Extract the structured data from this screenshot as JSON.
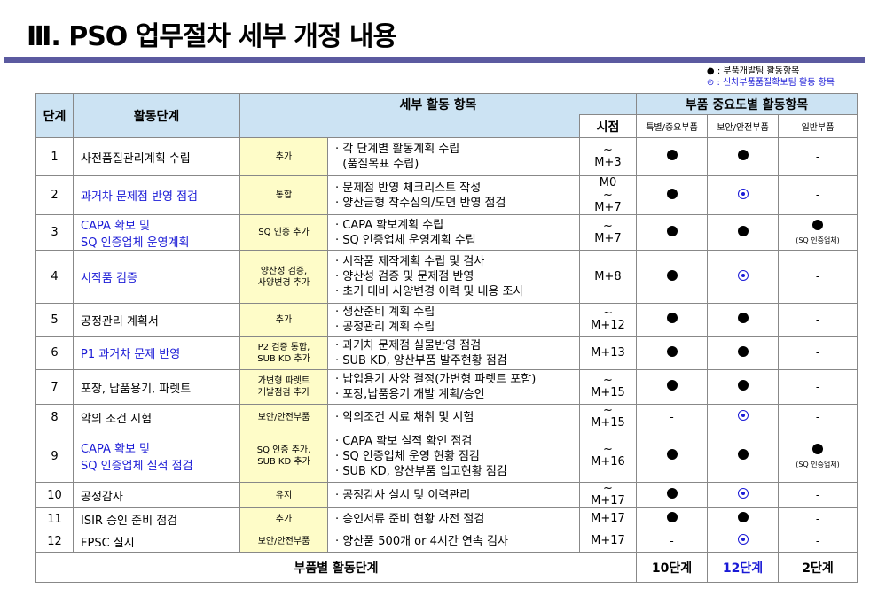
{
  "title": "Ⅲ. PSO 업무절차 세부 개정 내용",
  "legend": {
    "filled": "● : 부품개발팀 활동항목",
    "circled": "⊙ : 신차부품품질확보팀 활동 항목"
  },
  "header": {
    "stage": "단계",
    "activity": "활동단계",
    "detail": "세부 활동 항목",
    "timing": "시점",
    "importance": "부품 중요도별 활동항목",
    "cat1": "특별/중요부품",
    "cat2": "보안/안전부품",
    "cat3": "일반부품"
  },
  "rows": [
    {
      "no": "1",
      "activity": "사전품질관리계획 수립",
      "tag": "추가",
      "details": [
        "· 각 단계별 활동계획 수립",
        "  (품질목표 수립)"
      ],
      "time": "~\nM+3",
      "c1": "dot",
      "c2": "dot",
      "c3": "-"
    },
    {
      "no": "2",
      "activity": "과거차 문제점 반영 점검",
      "tag": "통합",
      "details": [
        "· 문제점 반영 체크리스트 작성",
        "· 양산금형 착수심의/도면 반영 점검"
      ],
      "time": "M0\n~\nM+7",
      "c1": "dot",
      "c2": "odot",
      "c3": "-"
    },
    {
      "no": "3",
      "activity": "CAPA 확보 및\nSQ 인증업체 운영계획",
      "tag": "SQ 인증 추가",
      "details": [
        "· CAPA 확보계획 수립",
        "· SQ 인증업체 운영계획 수립"
      ],
      "time": "~\nM+7",
      "c1": "dot",
      "c2": "dot",
      "c3": "dot",
      "c3note": "(SQ 인증업체)"
    },
    {
      "no": "4",
      "activity": "시작품 검증",
      "tag": "양산성 검증,\n사양변경 추가",
      "details": [
        "· 시작품 제작계획 수립 및 검사",
        "· 양산성 검증 및 문제점 반영",
        "· 초기 대비 사양변경 이력 및 내용 조사"
      ],
      "time": "M+8",
      "c1": "dot",
      "c2": "odot",
      "c3": "-"
    },
    {
      "no": "5",
      "activity": "공정관리 계획서",
      "tag": "추가",
      "details": [
        "· 생산준비 계획 수립",
        "· 공정관리 계획 수립"
      ],
      "time": "~\nM+12",
      "c1": "dot",
      "c2": "dot",
      "c3": "-"
    },
    {
      "no": "6",
      "activity": "P1 과거차 문제 반영",
      "tag": "P2 검증 통합,\nSUB KD 추가",
      "details": [
        "· 과거차 문제점 실물반영 점검",
        "· SUB KD, 양산부품 발주현황 점검"
      ],
      "time": "M+13",
      "c1": "dot",
      "c2": "dot",
      "c3": "-"
    },
    {
      "no": "7",
      "activity": "포장, 납품용기, 파렛트",
      "tag": "가변형 파렛트\n개발점검 추가",
      "details": [
        "· 납입용기 사양 결정(가변형 파렛트 포함)",
        "· 포장,납품용기 개발 계획/승인"
      ],
      "time": "~\nM+15",
      "c1": "dot",
      "c2": "dot",
      "c3": "-"
    },
    {
      "no": "8",
      "activity": "악의 조건 시험",
      "tag": "보안/안전부품",
      "details": [
        "· 악의조건 시료 채취 및 시험"
      ],
      "time": "~\nM+15",
      "c1": "-",
      "c2": "odot",
      "c3": "-"
    },
    {
      "no": "9",
      "activity": "CAPA 확보 및\nSQ 인증업체 실적 점검",
      "tag": "SQ 인증 추가,\nSUB KD 추가",
      "details": [
        "· CAPA 확보 실적 확인 점검",
        "· SQ 인증업체 운영 현황 점검",
        "· SUB KD, 양산부품 입고현황 점검"
      ],
      "time": "~\nM+16",
      "c1": "dot",
      "c2": "dot",
      "c3": "dot",
      "c3note": "(SQ 인증업체)"
    },
    {
      "no": "10",
      "activity": "공정감사",
      "tag": "유지",
      "details": [
        "· 공정감사 실시 및 이력관리"
      ],
      "time": "~\nM+17",
      "c1": "dot",
      "c2": "odot",
      "c3": "-"
    },
    {
      "no": "11",
      "activity": "ISIR 승인 준비 점검",
      "tag": "추가",
      "details": [
        "· 승인서류 준비 현황 사전 점검"
      ],
      "time": "M+17",
      "c1": "dot",
      "c2": "dot",
      "c3": "-"
    },
    {
      "no": "12",
      "activity": "FPSC 실시",
      "tag": "보안/안전부품",
      "details": [
        "· 양산품 500개 or 4시간 연속 검사"
      ],
      "time": "M+17",
      "c1": "-",
      "c2": "odot",
      "c3": "-"
    }
  ],
  "blue_rows": [
    "2",
    "3",
    "4",
    "6",
    "9"
  ],
  "footer": {
    "label": "부품별 활동단계",
    "v1": "10단계",
    "v2": "12단계",
    "v3": "2단계"
  }
}
